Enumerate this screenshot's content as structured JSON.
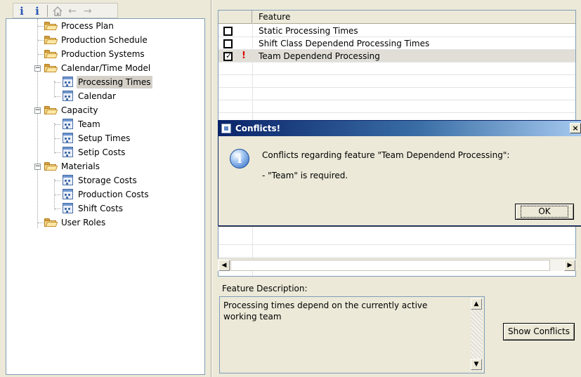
{
  "tree": {
    "items": [
      {
        "label": "Process Plan",
        "icon": "folder-icon"
      },
      {
        "label": "Production Schedule",
        "icon": "folder-icon"
      },
      {
        "label": "Production Systems",
        "icon": "folder-icon"
      },
      {
        "label": "Calendar/Time Model",
        "icon": "folder-icon",
        "expanded": true
      },
      {
        "label": "Processing Times",
        "icon": "document-icon",
        "selected": true
      },
      {
        "label": "Calendar",
        "icon": "document-icon"
      },
      {
        "label": "Capacity",
        "icon": "folder-icon",
        "expanded": true
      },
      {
        "label": "Team",
        "icon": "document-icon"
      },
      {
        "label": "Setup Times",
        "icon": "document-icon"
      },
      {
        "label": "Setip Costs",
        "icon": "document-icon"
      },
      {
        "label": "Materials",
        "icon": "folder-icon",
        "expanded": true
      },
      {
        "label": "Storage Costs",
        "icon": "document-icon"
      },
      {
        "label": "Production Costs",
        "icon": "document-icon"
      },
      {
        "label": "Shift Costs",
        "icon": "document-icon"
      },
      {
        "label": "User Roles",
        "icon": "folder-icon"
      }
    ]
  },
  "toolbar": {
    "info1": "i",
    "info2": "i",
    "home_icon": "home-icon",
    "back_icon": "←",
    "forward_icon": "→"
  },
  "feature_table": {
    "header": "Feature",
    "rows": [
      {
        "checked": false,
        "warning": "",
        "label": "Static Processing Times"
      },
      {
        "checked": false,
        "warning": "",
        "label": "Shift Class Dependend Processing Times"
      },
      {
        "checked": true,
        "warning": "!",
        "label": "Team Dependend Processing"
      }
    ]
  },
  "dialog": {
    "title": "Conflicts!",
    "message": "Conflicts regarding feature \"Team Dependend Processing\":",
    "detail": "- \"Team\" is required.",
    "ok_label": "OK",
    "close_glyph": "×"
  },
  "description": {
    "label": "Feature Description:",
    "text": "Processing times depend on the currently active working team"
  },
  "buttons": {
    "show_conflicts": "Show Conflicts"
  },
  "colors": {
    "title_bar_start": "#0a246a",
    "title_bar_end": "#a6caf0",
    "warning": "#dd0000",
    "window_bg": "#ece9d8"
  }
}
